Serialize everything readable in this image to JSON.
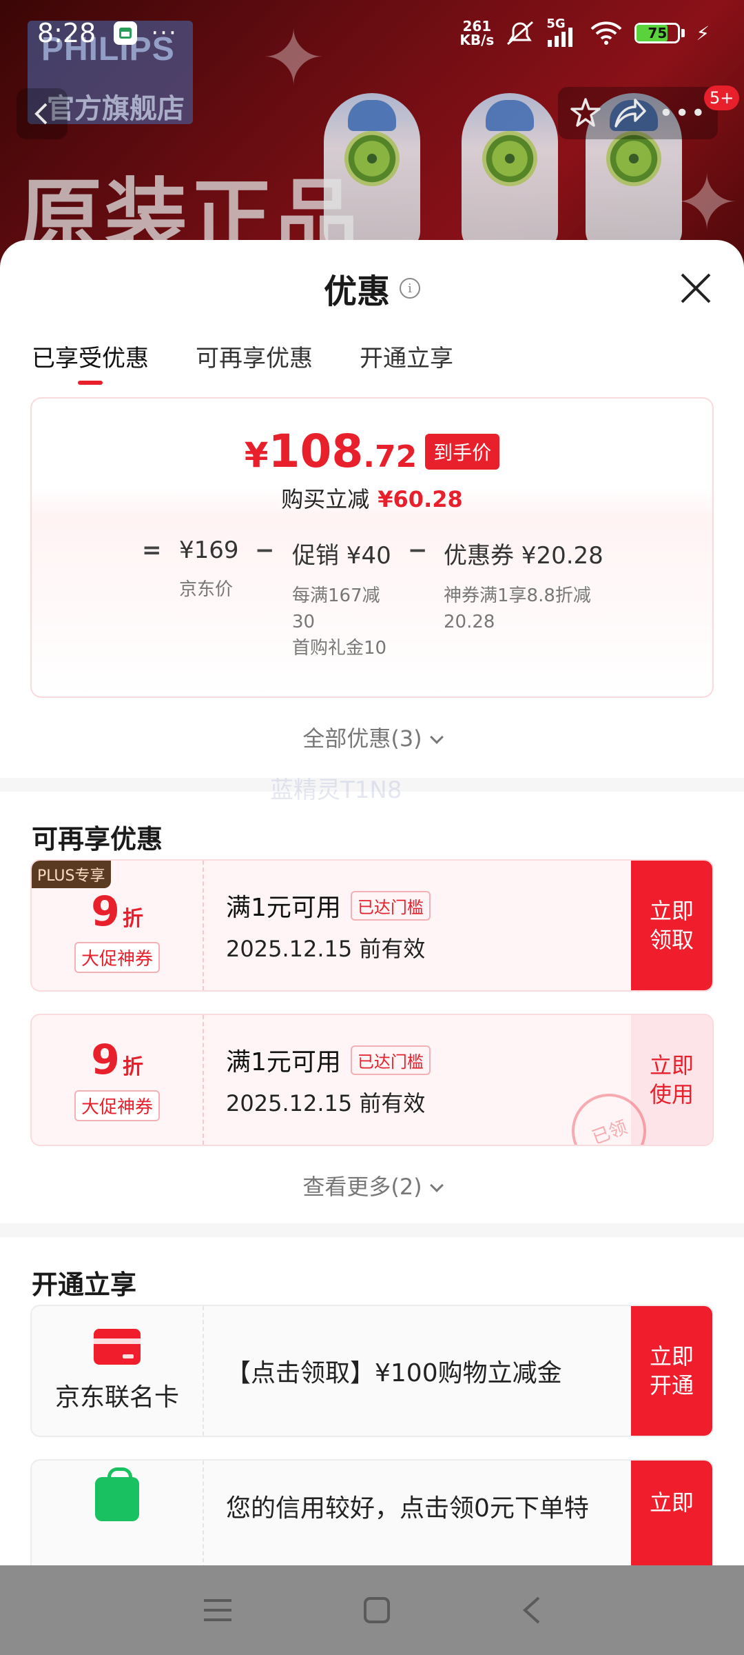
{
  "status_bar": {
    "time": "8:28",
    "more": "···",
    "net_speed_value": "261",
    "net_speed_unit": "KB/s",
    "network": "5G",
    "battery": "75"
  },
  "background": {
    "brand": "PHILIPS",
    "store": "官方旗舰店",
    "banner_text": "原装正品",
    "notification_badge": "5+"
  },
  "sheet": {
    "title": "优惠",
    "tabs": [
      {
        "label": "已享受优惠",
        "active": true
      },
      {
        "label": "可再享优惠",
        "active": false
      },
      {
        "label": "开通立享",
        "active": false
      }
    ]
  },
  "price": {
    "currency": "¥",
    "final_int": "108",
    "final_dec": ".72",
    "final_tag": "到手价",
    "reduce_label": "购买立减",
    "reduce_value": "¥60.28",
    "equals": "=",
    "minus": "−",
    "jd_price": "¥169",
    "jd_price_label": "京东价",
    "promo": "促销 ¥40",
    "promo_desc_1": "每满167减",
    "promo_desc_2": "30",
    "promo_desc_3": "首购礼金10",
    "coupon": "优惠券 ¥20.28",
    "coupon_desc_1": "神券满1享8.8折减",
    "coupon_desc_2": "20.28"
  },
  "all_discount": "全部优惠(3)",
  "watermark": "蓝精灵T1N8",
  "reuse_section": {
    "title": "可再享优惠",
    "coupons": [
      {
        "plus_tag": "PLUS专享",
        "discount": "9",
        "unit": "折",
        "tag": "大促神券",
        "condition": "满1元可用",
        "reached": "已达门槛",
        "valid": "2025.12.15 前有效",
        "button": "立即领取"
      },
      {
        "discount": "9",
        "unit": "折",
        "tag": "大促神券",
        "condition": "满1元可用",
        "reached": "已达门槛",
        "valid": "2025.12.15 前有效",
        "button": "立即使用",
        "stamp": "已领"
      }
    ],
    "view_more": "查看更多(2)"
  },
  "open_section": {
    "title": "开通立享",
    "cards": [
      {
        "name": "京东联名卡",
        "desc": "【点击领取】¥100购物立减金",
        "button": "立即开通"
      },
      {
        "desc": "您的信用较好，点击领0元下单特",
        "button": "立即"
      }
    ]
  },
  "colors": {
    "accent": "#e8202c",
    "coupon_bg": "#fff5f6",
    "plus_tag_bg": "#5b3a22"
  }
}
